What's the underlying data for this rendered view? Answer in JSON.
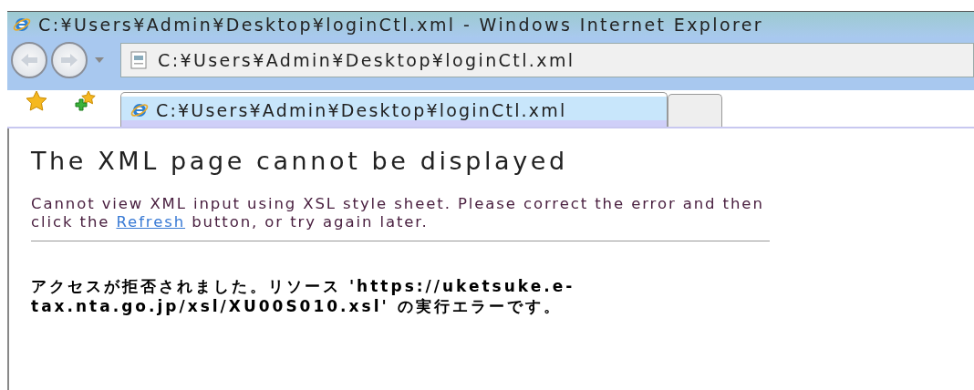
{
  "window": {
    "title": "C:¥Users¥Admin¥Desktop¥loginCtl.xml - Windows Internet Explorer"
  },
  "address_bar": {
    "value": "C:¥Users¥Admin¥Desktop¥loginCtl.xml"
  },
  "tabs": [
    {
      "label": "C:¥Users¥Admin¥Desktop¥loginCtl.xml",
      "selected": true
    },
    {
      "selected": false
    }
  ],
  "page": {
    "heading": "The XML page cannot be displayed",
    "message": {
      "before": "Cannot view XML input using XSL style sheet. Please correct the error and then click the",
      "link": "Refresh",
      "after": "button, or try again later."
    },
    "error": "アクセスが拒否されました。リソース 'https://uketsuke.e-tax.nta.go.jp/xsl/XU00S010.xsl' の実行エラーです。"
  }
}
